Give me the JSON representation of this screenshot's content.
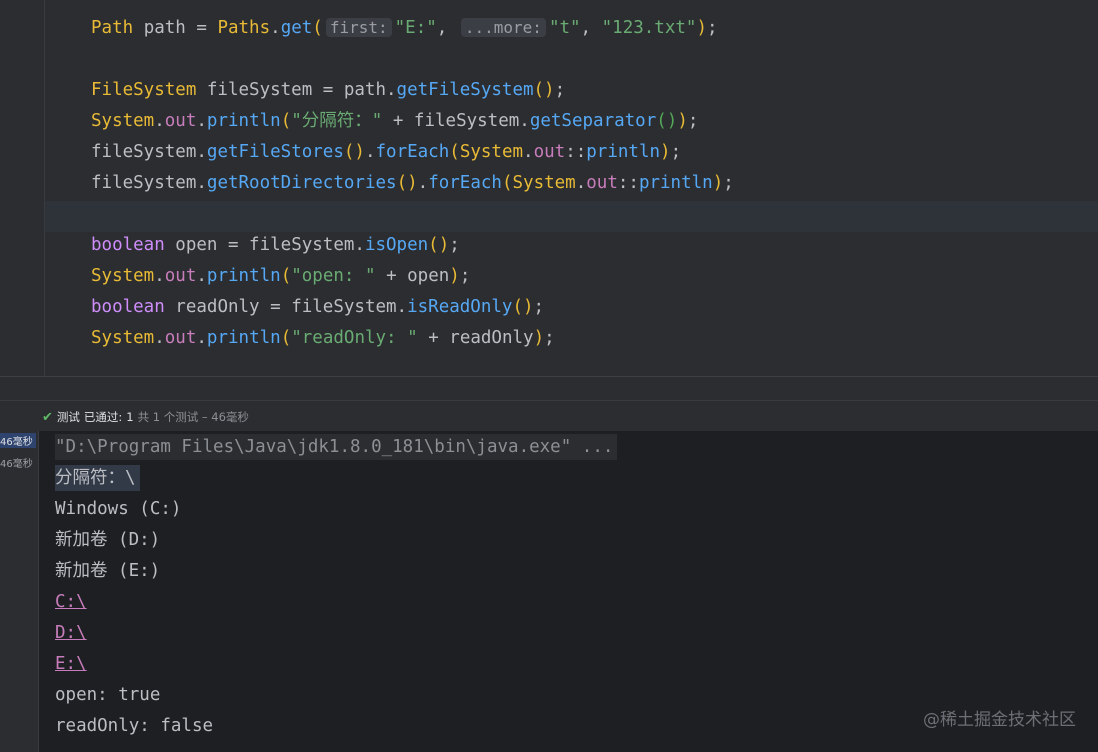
{
  "editor": {
    "lines": [
      [
        [
          "t-cls",
          "Path"
        ],
        [
          "t-plain",
          " path = "
        ],
        [
          "t-cls",
          "Paths"
        ],
        [
          "t-plain",
          "."
        ],
        [
          "t-fn",
          "get"
        ],
        [
          "t-p1",
          "("
        ],
        [
          "hint",
          "first:"
        ],
        [
          "t-str",
          "\"E:\""
        ],
        [
          "t-plain",
          ", "
        ],
        [
          "hint",
          "...more:"
        ],
        [
          "t-str",
          "\"t\""
        ],
        [
          "t-plain",
          ", "
        ],
        [
          "t-str",
          "\"123.txt\""
        ],
        [
          "t-p1",
          ")"
        ],
        [
          "t-plain",
          ";"
        ]
      ],
      [],
      [
        [
          "t-cls",
          "FileSystem"
        ],
        [
          "t-plain",
          " fileSystem = path."
        ],
        [
          "t-fn",
          "getFileSystem"
        ],
        [
          "t-p1",
          "()"
        ],
        [
          "t-plain",
          ";"
        ]
      ],
      [
        [
          "t-cls",
          "System"
        ],
        [
          "t-plain",
          "."
        ],
        [
          "t-fld",
          "out"
        ],
        [
          "t-plain",
          "."
        ],
        [
          "t-fn",
          "println"
        ],
        [
          "t-p1",
          "("
        ],
        [
          "t-str",
          "\"分隔符：\""
        ],
        [
          "t-plain",
          " + fileSystem."
        ],
        [
          "t-fn",
          "getSeparator"
        ],
        [
          "t-p2",
          "()"
        ],
        [
          "t-p1",
          ")"
        ],
        [
          "t-plain",
          ";"
        ]
      ],
      [
        [
          "t-plain",
          "fileSystem."
        ],
        [
          "t-fn",
          "getFileStores"
        ],
        [
          "t-p1",
          "()"
        ],
        [
          "t-plain",
          "."
        ],
        [
          "t-fn",
          "forEach"
        ],
        [
          "t-p1",
          "("
        ],
        [
          "t-cls",
          "System"
        ],
        [
          "t-plain",
          "."
        ],
        [
          "t-fld",
          "out"
        ],
        [
          "t-plain",
          "::"
        ],
        [
          "t-fn",
          "println"
        ],
        [
          "t-p1",
          ")"
        ],
        [
          "t-plain",
          ";"
        ]
      ],
      [
        [
          "t-plain",
          "fileSystem."
        ],
        [
          "t-fn",
          "getRootDirectories"
        ],
        [
          "t-p1",
          "()"
        ],
        [
          "t-plain",
          "."
        ],
        [
          "t-fn",
          "forEach"
        ],
        [
          "t-p1",
          "("
        ],
        [
          "t-cls",
          "System"
        ],
        [
          "t-plain",
          "."
        ],
        [
          "t-fld",
          "out"
        ],
        [
          "t-plain",
          "::"
        ],
        [
          "t-fn",
          "println"
        ],
        [
          "t-p1",
          ")"
        ],
        [
          "t-plain",
          ";"
        ]
      ],
      [],
      [
        [
          "t-kw",
          "boolean"
        ],
        [
          "t-plain",
          " open = fileSystem."
        ],
        [
          "t-fn",
          "isOpen"
        ],
        [
          "t-p1",
          "()"
        ],
        [
          "t-plain",
          ";"
        ]
      ],
      [
        [
          "t-cls",
          "System"
        ],
        [
          "t-plain",
          "."
        ],
        [
          "t-fld",
          "out"
        ],
        [
          "t-plain",
          "."
        ],
        [
          "t-fn",
          "println"
        ],
        [
          "t-p1",
          "("
        ],
        [
          "t-str",
          "\"open: \""
        ],
        [
          "t-plain",
          " + open"
        ],
        [
          "t-p1",
          ")"
        ],
        [
          "t-plain",
          ";"
        ]
      ],
      [
        [
          "t-kw",
          "boolean"
        ],
        [
          "t-plain",
          " readOnly = fileSystem."
        ],
        [
          "t-fn",
          "isReadOnly"
        ],
        [
          "t-p1",
          "()"
        ],
        [
          "t-plain",
          ";"
        ]
      ],
      [
        [
          "t-cls",
          "System"
        ],
        [
          "t-plain",
          "."
        ],
        [
          "t-fld",
          "out"
        ],
        [
          "t-plain",
          "."
        ],
        [
          "t-fn",
          "println"
        ],
        [
          "t-p1",
          "("
        ],
        [
          "t-str",
          "\"readOnly: \""
        ],
        [
          "t-plain",
          " + readOnly"
        ],
        [
          "t-p1",
          ")"
        ],
        [
          "t-plain",
          ";"
        ]
      ]
    ]
  },
  "test_status": {
    "label_test": "测试",
    "label_passed": "已通过:",
    "passed_count": "1",
    "summary": "共 1 个测试 – 46毫秒"
  },
  "test_tree": {
    "durations": [
      "46毫秒",
      "46毫秒"
    ]
  },
  "console": {
    "lines": [
      {
        "text": "\"D:\\Program Files\\Java\\jdk1.8.0_181\\bin\\java.exe\" ...",
        "style": "cmd"
      },
      {
        "text": "分隔符：\\",
        "style": "hl"
      },
      {
        "text": "Windows (C:)",
        "style": ""
      },
      {
        "text": "新加卷 (D:)",
        "style": ""
      },
      {
        "text": "新加卷 (E:)",
        "style": ""
      },
      {
        "text": "C:\\",
        "style": "link"
      },
      {
        "text": "D:\\",
        "style": "link"
      },
      {
        "text": "E:\\",
        "style": "link"
      },
      {
        "text": "open: true",
        "style": ""
      },
      {
        "text": "readOnly: false",
        "style": ""
      }
    ]
  },
  "watermark": "@稀土掘金技术社区"
}
